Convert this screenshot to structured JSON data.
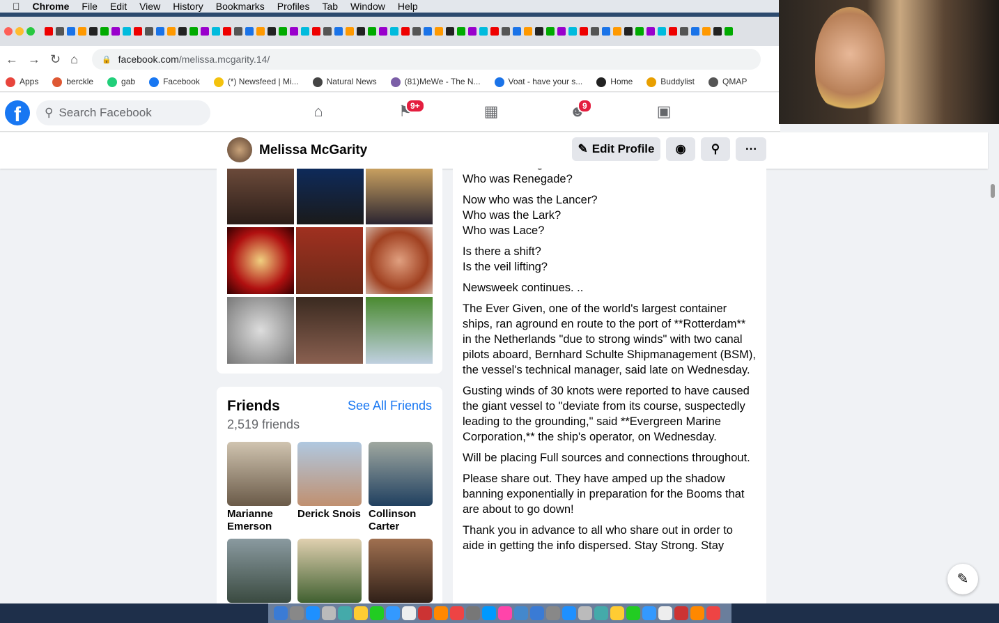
{
  "menubar": {
    "app": "Chrome",
    "items": [
      "File",
      "Edit",
      "View",
      "History",
      "Bookmarks",
      "Profiles",
      "Tab",
      "Window",
      "Help"
    ]
  },
  "address": {
    "domain": "facebook.com",
    "path": "/melissa.mcgarity.14/"
  },
  "bookmarks": [
    {
      "label": "Apps",
      "color": "#e8453c"
    },
    {
      "label": "berckle",
      "color": "#de5833"
    },
    {
      "label": "gab",
      "color": "#21cf7a"
    },
    {
      "label": "Facebook",
      "color": "#1877f2"
    },
    {
      "label": "(*) Newsfeed | Mi...",
      "color": "#f4c20d"
    },
    {
      "label": "Natural News",
      "color": "#444"
    },
    {
      "label": "(81)MeWe - The N...",
      "color": "#7b5ea7"
    },
    {
      "label": "Voat - have your s...",
      "color": "#1a73e8"
    },
    {
      "label": "Home",
      "color": "#222"
    },
    {
      "label": "Buddylist",
      "color": "#e89f00"
    },
    {
      "label": "QMAP",
      "color": "#555"
    }
  ],
  "fb": {
    "search_placeholder": "Search Facebook",
    "badges": {
      "pages": "9+",
      "groups": "9"
    }
  },
  "profile": {
    "name": "Melissa McGarity",
    "edit_label": "Edit Profile"
  },
  "friends": {
    "title": "Friends",
    "see_all": "See All Friends",
    "count": "2,519 friends",
    "list": [
      {
        "name": "Marianne Emerson"
      },
      {
        "name": "Derick Snois"
      },
      {
        "name": "Collinson Carter"
      }
    ]
  },
  "post": {
    "paragraphs": [
      "Who was Evergreen?\nWho was Renegade?",
      "Now who was the Lancer?\nWho was the Lark?\nWho was Lace?",
      "Is there a shift?\nIs the veil lifting?",
      "Newsweek continues. ..",
      "The Ever Given, one of the world's largest container ships, ran aground en route to the port of **Rotterdam** in the Netherlands \"due to strong winds\" with two canal pilots aboard, Bernhard Schulte Shipmanagement (BSM), the vessel's technical manager, said late on Wednesday.",
      "Gusting winds of 30 knots were reported to have caused the giant vessel to \"deviate from its course, suspectedly leading to the grounding,\" said **Evergreen Marine Corporation,** the ship's operator, on Wednesday.",
      "Will be placing Full sources and connections throughout.",
      "Please share out.  They have amped up the shadow banning exponentially in preparation for the Booms that are about to go down!",
      "Thank you in advance to all who share out in order to aide in getting the info dispersed.  Stay Strong. Stay"
    ]
  },
  "colors": {
    "fb_blue": "#1877f2",
    "badge_red": "#e41e3f"
  }
}
